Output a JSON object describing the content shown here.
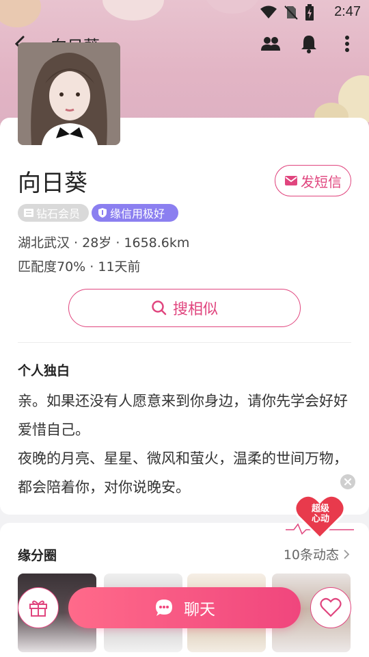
{
  "status_bar": {
    "time": "2:47",
    "icons": [
      "wifi-icon",
      "no-sim-icon",
      "battery-charging-icon"
    ]
  },
  "header": {
    "title": "向日葵",
    "icons": [
      "back-icon",
      "group-icon",
      "bell-icon",
      "more-icon"
    ]
  },
  "profile": {
    "name": "向日葵",
    "sms_label": "发短信",
    "badges": {
      "vip": "钻石会员",
      "credit": "缘信用极好"
    },
    "location_line": "湖北武汉 · 28岁 · 1658.6km",
    "match_line": "匹配度70% · 11天前",
    "search_similar_label": "搜相似"
  },
  "bio": {
    "title": "个人独白",
    "text": "亲。如果还没有人愿意来到你身边，请你先学会好好爱惜自己。\n夜晚的月亮、星星、微风和萤火，温柔的世间万物，都会陪着你，对你说晚安。"
  },
  "super_like": {
    "label_line1": "超级",
    "label_line2": "心动"
  },
  "moments": {
    "title": "缘分圈",
    "count_label": "10条动态"
  },
  "bottom_bar": {
    "chat_label": "聊天"
  },
  "colors": {
    "accent": "#e0457e",
    "chat_gradient_start": "#ff6a8a",
    "chat_gradient_end": "#f0467d",
    "credit_badge": "#8b7ff0",
    "vip_badge": "#d9d9d9"
  }
}
